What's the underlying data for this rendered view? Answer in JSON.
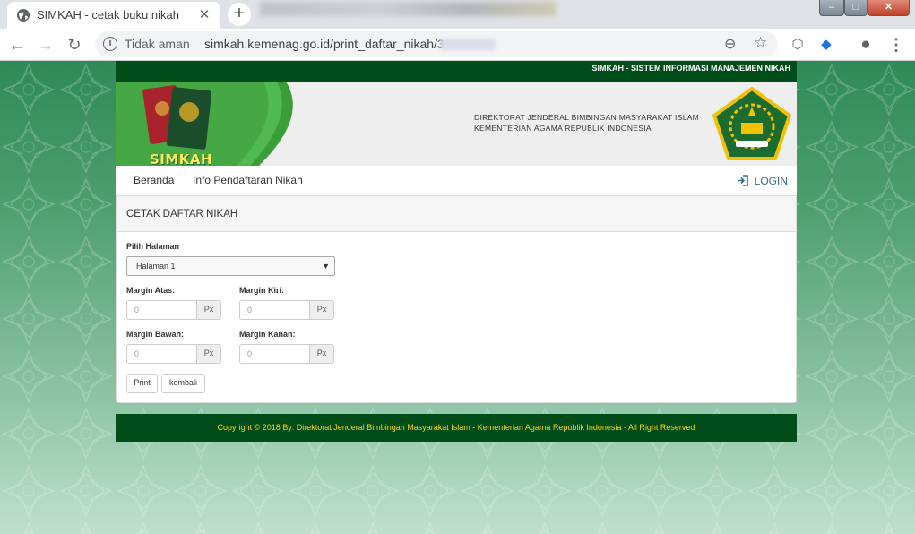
{
  "browser": {
    "tab_title": "SIMKAH - cetak buku nikah",
    "tab_close": "✕",
    "new_tab": "+",
    "security_label": "Tidak aman",
    "url": "simkah.kemenag.go.id/print_daftar_nikah/3"
  },
  "site": {
    "topbar_title": "SIMKAH - SISTEM INFORMASI MANAJEMEN NIKAH",
    "brand": "SIMKAH",
    "org_line1": "DIREKTORAT JENDERAL BIMBINGAN MASYARAKAT ISLAM",
    "org_line2": "KEMENTERIAN AGAMA REPUBLIK INDONESIA",
    "nav": {
      "items": [
        {
          "label": "Beranda"
        },
        {
          "label": "Info Pendaftaran Nikah"
        }
      ],
      "login": "LOGIN"
    },
    "panel": {
      "title": "CETAK DAFTAR NIKAH",
      "page_select_label": "Pilih Halaman",
      "page_select_value": "Halaman 1",
      "margin_top_label": "Margin Atas:",
      "margin_left_label": "Margin Kiri:",
      "margin_bottom_label": "Margin Bawah:",
      "margin_right_label": "Margin Kanan:",
      "margin_top_placeholder": "0",
      "margin_left_placeholder": "0",
      "margin_bottom_placeholder": "0",
      "margin_right_placeholder": "0",
      "unit": "Px",
      "print_button": "Print",
      "back_button": "kembali"
    },
    "footer": "Copyright © 2018 By: Direktorat Jenderal Bimbingan Masyarakat Islam - Kementerian Agama Republik Indonesia - All Right Reserved"
  },
  "colors": {
    "header_green": "#004d1a",
    "footer_text": "#ffd800",
    "brand_yellow": "#ffe85a",
    "link_blue": "#2f6f8a"
  }
}
